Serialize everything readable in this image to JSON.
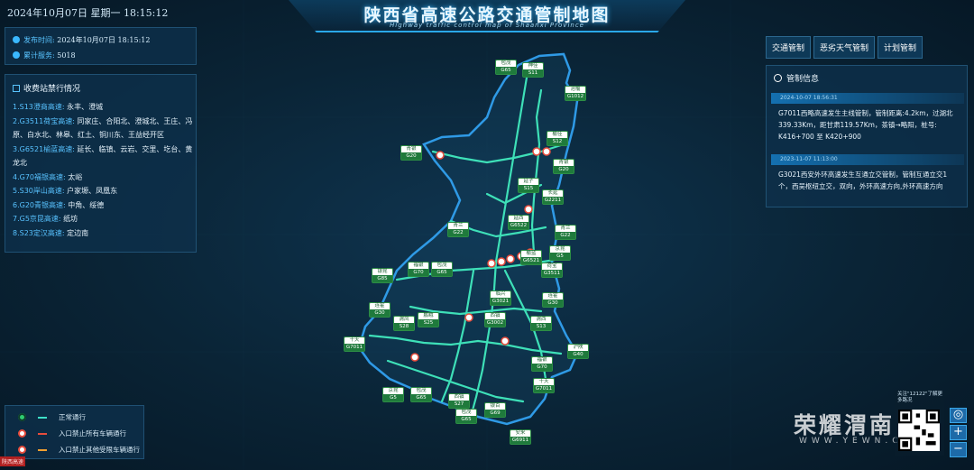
{
  "header": {
    "datetime": "2024年10月07日 星期一   18:15:12",
    "title": "陕西省高速公路交通管制地图",
    "subtitle": "Highway traffic control map of Shaanxi Province"
  },
  "info": {
    "publish_label": "发布时间:",
    "publish_time": "2024年10月07日  18:15:12",
    "service_label": "累计服务:",
    "service_count": "5018"
  },
  "closures": {
    "title": "收费站禁行情况",
    "items": [
      {
        "road": "1.S13澄商高速:",
        "stations": " 永丰、澄城"
      },
      {
        "road": "2.G3511荷宝高速:",
        "stations": " 同家庄、合阳北、澄城北、王庄、冯原、白水北、林皋、红土、铜川东、王益经开区"
      },
      {
        "road": "3.G6521榆蓝高速:",
        "stations": " 延长、临镇、云岩、交里、圪台、黄龙北"
      },
      {
        "road": "4.G70福银高速:",
        "stations": " 太峪"
      },
      {
        "road": "5.S30岸山高速:",
        "stations": " 户家塬、凤凰东"
      },
      {
        "road": "6.G20青银高速:",
        "stations": " 中角、绥德"
      },
      {
        "road": "7.G5京昆高速:",
        "stations": " 纸坊"
      },
      {
        "road": "8.S23定汉高速:",
        "stations": " 定边南"
      }
    ]
  },
  "tabs": [
    "交通管制",
    "恶劣天气管制",
    "计划管制"
  ],
  "control": {
    "title": "管制信息",
    "events": [
      {
        "time": "2024-10-07 18:56:31",
        "text": "G7011西略高速发生主线管制，管制距离:4.2km，过湖北339.33Km，距甘肃119.57Km，茶镇→略阳，桩号: K416+700 至 K420+900"
      },
      {
        "time": "2023-11-07 11:13:00",
        "text": "G3021西安外环高速发生互通立交管制，管制互通立交1个，西吴枢纽立交，双向，外环高速方向,外环高速方向"
      }
    ]
  },
  "legend": [
    {
      "label": "正常通行",
      "dot": "#2ecc71",
      "line": "#3ee0c8"
    },
    {
      "label": "入口禁止所有车辆通行",
      "dot": "#e74c3c",
      "line": "#e74c3c"
    },
    {
      "label": "入口禁止其他受限车辆通行",
      "dot": "#e74c3c",
      "line": "#f0a030"
    }
  ],
  "badges": [
    {
      "name": "包茂",
      "code": "G65"
    },
    {
      "name": "神佳",
      "code": "S11"
    },
    {
      "name": "沧榆",
      "code": "G1012"
    },
    {
      "name": "青银",
      "code": "G20"
    },
    {
      "name": "榆佳",
      "code": "S12"
    },
    {
      "name": "青银",
      "code": "G20"
    },
    {
      "name": "延子",
      "code": "S15"
    },
    {
      "name": "长延",
      "code": "G2211"
    },
    {
      "name": "青兰",
      "code": "G22"
    },
    {
      "name": "延西",
      "code": "G6522"
    },
    {
      "name": "青兰",
      "code": "G22"
    },
    {
      "name": "京昆",
      "code": "G5"
    },
    {
      "name": "榆蓝",
      "code": "G6521"
    },
    {
      "name": "荷宝",
      "code": "G3511"
    },
    {
      "name": "银昆",
      "code": "G85"
    },
    {
      "name": "福银",
      "code": "G70"
    },
    {
      "name": "包茂",
      "code": "G65"
    },
    {
      "name": "临兴",
      "code": "G3021"
    },
    {
      "name": "连霍",
      "code": "G30"
    },
    {
      "name": "连霍",
      "code": "G30"
    },
    {
      "name": "鹏峨",
      "code": "S25"
    },
    {
      "name": "西镇",
      "code": "G3002"
    },
    {
      "name": "渭凤",
      "code": "S28"
    },
    {
      "name": "渭西",
      "code": "S13"
    },
    {
      "name": "十天",
      "code": "G7011"
    },
    {
      "name": "沪陕",
      "code": "G40"
    },
    {
      "name": "福银",
      "code": "G70"
    },
    {
      "name": "十天",
      "code": "G7011"
    },
    {
      "name": "京昆",
      "code": "G5"
    },
    {
      "name": "包茂",
      "code": "G65"
    },
    {
      "name": "西镇",
      "code": "S27"
    },
    {
      "name": "包茂",
      "code": "G65"
    },
    {
      "name": "银百",
      "code": "G69"
    },
    {
      "name": "安来",
      "code": "G6911"
    }
  ],
  "watermark": {
    "brand": "荣耀渭南",
    "url": "WWW.YEWN.COM"
  },
  "qr": {
    "caption": "关注\"12122\"了解更多路况"
  },
  "zoom": {
    "in": "+",
    "out": "−",
    "locate": "◎"
  },
  "corner_logo": "陕西高速"
}
